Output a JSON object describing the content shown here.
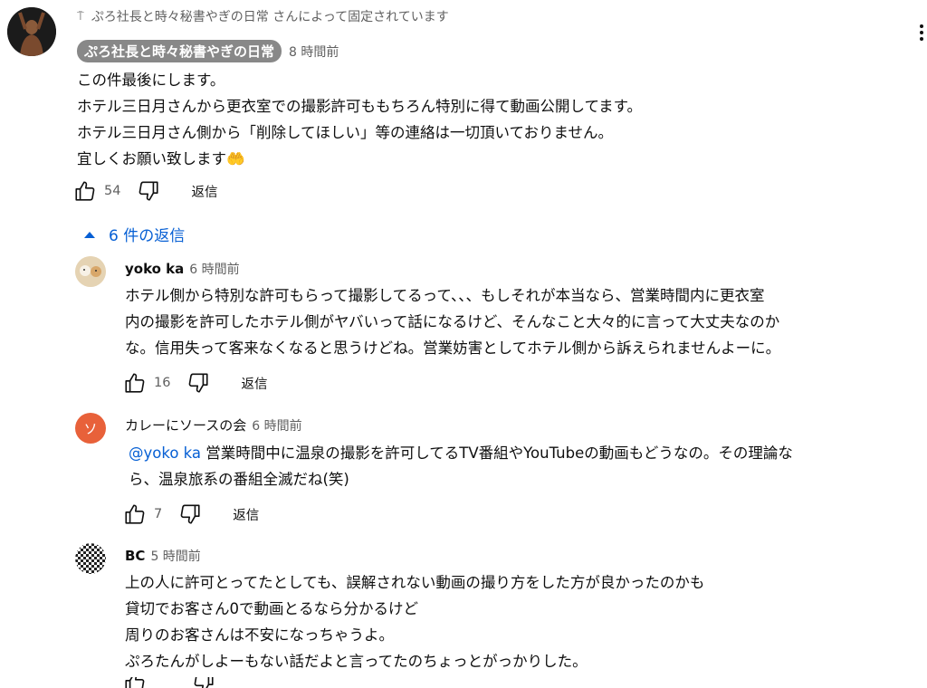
{
  "pinned_note": "ぷろ社長と時々秘書やぎの日常 さんによって固定されています",
  "main_comment": {
    "author": "ぷろ社長と時々秘書やぎの日常",
    "time": "8 時間前",
    "lines": [
      "この件最後にします。",
      "ホテル三日月さんから更衣室での撮影許可ももちろん特別に得て動画公開してます。",
      "ホテル三日月さん側から「削除してほしい」等の連絡は一切頂いておりません。",
      "宜しくお願い致します🤲"
    ],
    "likes": "54",
    "reply_label": "返信"
  },
  "replies_toggle": "6 件の返信",
  "replies": [
    {
      "author": "yoko ka",
      "time": "6 時間前",
      "lines": [
        "ホテル側から特別な許可もらって撮影してるって、、、もしそれが本当なら、営業時間内に更衣室",
        "内の撮影を許可したホテル側がヤバいって話になるけど、そんなこと大々的に言って大丈夫なのか",
        "な。信用失って客来なくなると思うけどね。営業妨害としてホテル側から訴えられませんよーに。"
      ],
      "likes": "16",
      "reply_label": "返信"
    },
    {
      "author": "カレーにソースの会",
      "time": "6 時間前",
      "avatar_letter": "ソ",
      "mention": "@yoko ka",
      "line1_rest": " 営業時間中に温泉の撮影を許可してるTV番組やYouTubeの動画もどうなの。その理論な",
      "line2": "ら、温泉旅系の番組全滅だね(笑)",
      "likes": "7",
      "reply_label": "返信"
    },
    {
      "author": "BC",
      "time": "5 時間前",
      "lines": [
        "上の人に許可とってたとしても、誤解されない動画の撮り方をした方が良かったのかも",
        "貸切でお客さん0で動画とるなら分かるけど",
        "周りのお客さんは不安になっちゃうよ。",
        "ぷろたんがしよーもない話だよと言ってたのちょっとがっかりした。"
      ]
    }
  ],
  "colors": {
    "link": "#065fd4",
    "chip_bg": "#888888",
    "orange_avatar": "#e8613a"
  }
}
